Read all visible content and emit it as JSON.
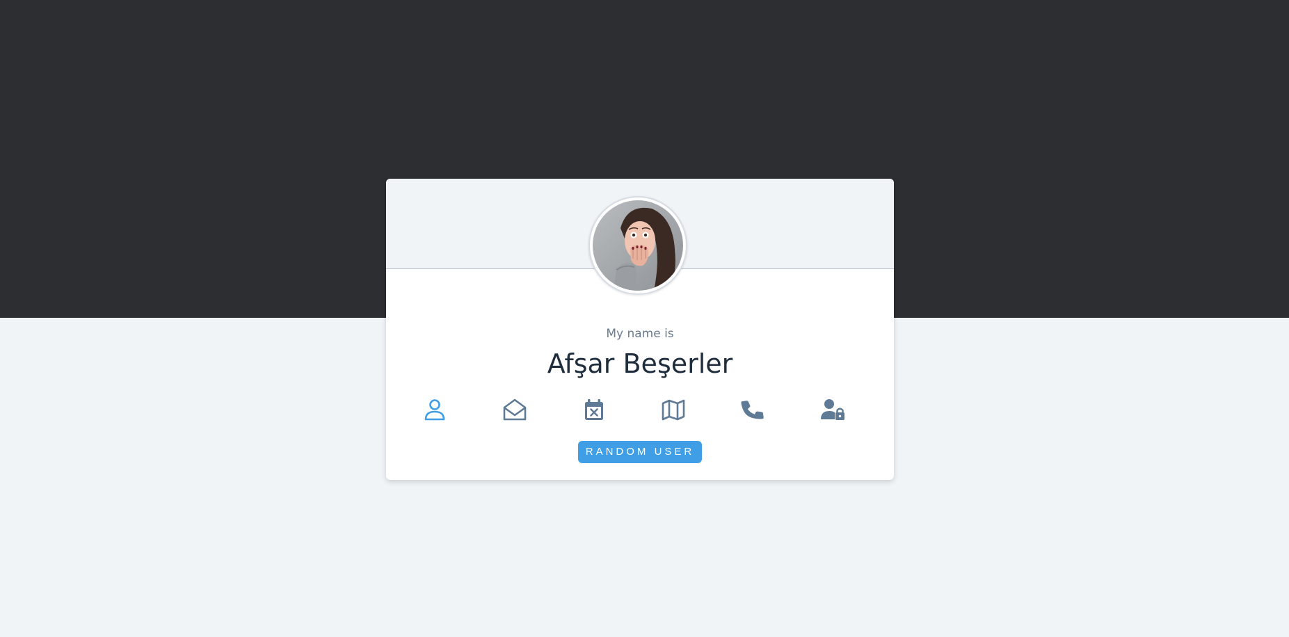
{
  "card": {
    "label": "My name is",
    "value": "Afşar Beşerler",
    "button_label": "RANDOM USER"
  },
  "icons": [
    {
      "name": "user-icon",
      "active": true
    },
    {
      "name": "envelope-open-icon",
      "active": false
    },
    {
      "name": "calendar-x-icon",
      "active": false
    },
    {
      "name": "map-icon",
      "active": false
    },
    {
      "name": "phone-icon",
      "active": false
    },
    {
      "name": "user-lock-icon",
      "active": false
    }
  ],
  "colors": {
    "dark_band": "#2d2e32",
    "page_bg": "#f0f4f7",
    "accent": "#3f9ee6",
    "icon_default": "#5f7a95",
    "name_text": "#1f2d3d",
    "label_text": "#6b7b8f"
  }
}
